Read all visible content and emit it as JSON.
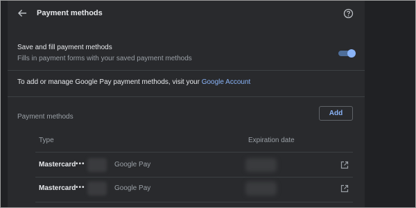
{
  "header": {
    "title": "Payment methods",
    "back_icon": "arrow-left-icon",
    "help_icon": "help-circle-icon"
  },
  "save_and_fill": {
    "title": "Save and fill payment methods",
    "description": "Fills in payment forms with your saved payment methods",
    "enabled": true
  },
  "google_pay_info": {
    "text": "To add or manage Google Pay payment methods, visit your ",
    "link_text": "Google Account"
  },
  "payment_methods": {
    "section_title": "Payment methods",
    "add_label": "Add",
    "columns": [
      "Type",
      "Expiration date"
    ],
    "cards": [
      {
        "brand": "Mastercard",
        "masked": "•••",
        "source": "Google Pay"
      },
      {
        "brand": "Mastercard",
        "masked": "•••",
        "source": "Google Pay"
      }
    ]
  },
  "colors": {
    "page_background": "#202124",
    "panel_background": "#292a2d",
    "accent": "#8ab4f8",
    "primary_text": "#e8eaed",
    "secondary_text": "#9aa0a6",
    "divider": "#3c4043"
  }
}
